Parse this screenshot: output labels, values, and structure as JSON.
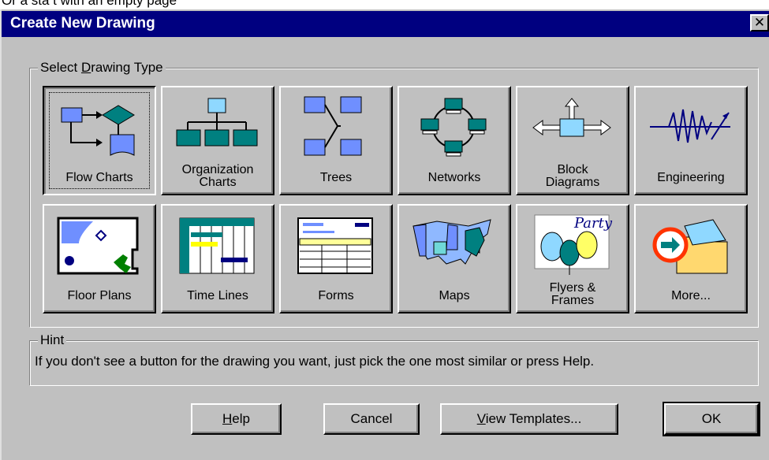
{
  "background_caption": "Or a sta t with an empty page",
  "window": {
    "title": "Create New Drawing",
    "close_glyph": "✕"
  },
  "type_group": {
    "legend_prefix": "Select ",
    "legend_mnemonic": "D",
    "legend_suffix": "rawing Type"
  },
  "tiles": [
    {
      "label": "Flow Charts",
      "icon": "flow-chart-icon"
    },
    {
      "label": "Organization\nCharts",
      "icon": "org-chart-icon"
    },
    {
      "label": "Trees",
      "icon": "tree-icon"
    },
    {
      "label": "Networks",
      "icon": "network-icon"
    },
    {
      "label": "Block\nDiagrams",
      "icon": "block-diagram-icon"
    },
    {
      "label": "Engineering",
      "icon": "engineering-icon"
    },
    {
      "label": "Floor Plans",
      "icon": "floor-plan-icon"
    },
    {
      "label": "Time Lines",
      "icon": "timeline-icon"
    },
    {
      "label": "Forms",
      "icon": "form-icon"
    },
    {
      "label": "Maps",
      "icon": "map-icon"
    },
    {
      "label": "Flyers &\nFrames",
      "icon": "flyer-icon",
      "flyer_word": "Party"
    },
    {
      "label": "More...",
      "icon": "more-folder-icon"
    }
  ],
  "hint": {
    "legend": "Hint",
    "text": "If you don't see a button for the drawing you want, just pick the one most similar or press Help."
  },
  "buttons": {
    "help": {
      "mnemonic": "H",
      "rest": "elp"
    },
    "cancel": "Cancel",
    "view_templates": {
      "mnemonic": "V",
      "rest": "iew Templates..."
    },
    "ok": "OK"
  },
  "colors": {
    "title_bar": "#000080",
    "face": "#c0c0c0",
    "teal": "#008080",
    "blue": "#6f8fff",
    "light_blue": "#8fd8ff"
  }
}
